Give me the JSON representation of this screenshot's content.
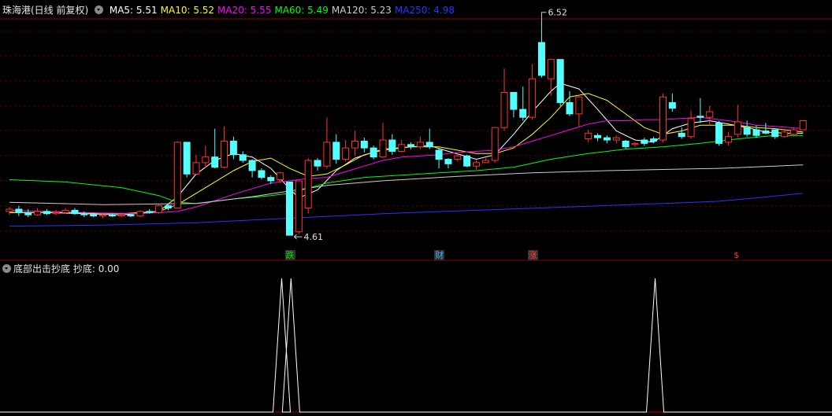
{
  "header": {
    "title": "珠海港(日线 前复权)",
    "ma_items": [
      {
        "label": "MA5: 5.51",
        "color": "#ffffff"
      },
      {
        "label": "MA10: 5.52",
        "color": "#ffff00"
      },
      {
        "label": "MA20: 5.55",
        "color": "#ff00ff"
      },
      {
        "label": "MA60: 5.49",
        "color": "#00ff00"
      },
      {
        "label": "MA120: 5.23",
        "color": "#cccccc"
      },
      {
        "label": "MA250: 4.98",
        "color": "#3030ff"
      }
    ]
  },
  "sub_header": {
    "title": "底部出击抄底",
    "value_label": "抄底: 0.00"
  },
  "markers": [
    {
      "text": "跌",
      "color": "#00e000",
      "bg": "#303030",
      "index": 30
    },
    {
      "text": "财",
      "color": "#4aa8ff",
      "bg": "#303030",
      "index": 46
    },
    {
      "text": "涨",
      "color": "#ff4040",
      "bg": "#303030",
      "index": 56
    },
    {
      "text": "$",
      "color": "#ff3030",
      "bg": "#000000",
      "index": 78
    }
  ],
  "chart_data": {
    "type": "candlestick",
    "price_range": [
      4.5,
      6.65
    ],
    "high_label": "6.52",
    "low_label": "4.61",
    "candles": [
      [
        4.82,
        4.84,
        4.86,
        4.79
      ],
      [
        4.84,
        4.81,
        4.87,
        4.78
      ],
      [
        4.81,
        4.79,
        4.84,
        4.77
      ],
      [
        4.79,
        4.82,
        4.85,
        4.78
      ],
      [
        4.82,
        4.8,
        4.84,
        4.79
      ],
      [
        4.8,
        4.81,
        4.83,
        4.79
      ],
      [
        4.81,
        4.83,
        4.85,
        4.8
      ],
      [
        4.83,
        4.8,
        4.85,
        4.79
      ],
      [
        4.8,
        4.79,
        4.82,
        4.77
      ],
      [
        4.79,
        4.78,
        4.81,
        4.77
      ],
      [
        4.78,
        4.79,
        4.8,
        4.76
      ],
      [
        4.79,
        4.78,
        4.8,
        4.77
      ],
      [
        4.78,
        4.79,
        4.81,
        4.77
      ],
      [
        4.79,
        4.78,
        4.8,
        4.77
      ],
      [
        4.78,
        4.82,
        4.83,
        4.77
      ],
      [
        4.82,
        4.81,
        4.84,
        4.8
      ],
      [
        4.81,
        4.87,
        4.88,
        4.8
      ],
      [
        4.87,
        4.85,
        4.89,
        4.83
      ],
      [
        4.85,
        5.43,
        5.44,
        4.85
      ],
      [
        5.43,
        5.15,
        5.43,
        5.12
      ],
      [
        5.15,
        5.25,
        5.32,
        5.14
      ],
      [
        5.25,
        5.3,
        5.4,
        5.2
      ],
      [
        5.3,
        5.21,
        5.55,
        5.2
      ],
      [
        5.21,
        5.44,
        5.57,
        5.2
      ],
      [
        5.44,
        5.32,
        5.48,
        5.28
      ],
      [
        5.32,
        5.27,
        5.35,
        5.25
      ],
      [
        5.27,
        5.18,
        5.28,
        5.12
      ],
      [
        5.18,
        5.12,
        5.2,
        5.1
      ],
      [
        5.12,
        5.09,
        5.14,
        5.06
      ],
      [
        5.1,
        5.16,
        5.17,
        5.07
      ],
      [
        5.08,
        4.61,
        5.08,
        4.61
      ],
      [
        4.64,
        5.09,
        5.09,
        4.62
      ],
      [
        4.85,
        5.27,
        5.29,
        4.8
      ],
      [
        5.27,
        5.22,
        5.29,
        5.18
      ],
      [
        5.22,
        5.43,
        5.65,
        5.2
      ],
      [
        5.43,
        5.28,
        5.5,
        5.24
      ],
      [
        5.28,
        5.38,
        5.45,
        5.26
      ],
      [
        5.38,
        5.44,
        5.53,
        5.31
      ],
      [
        5.44,
        5.38,
        5.47,
        5.34
      ],
      [
        5.38,
        5.3,
        5.4,
        5.28
      ],
      [
        5.3,
        5.45,
        5.6,
        5.29
      ],
      [
        5.45,
        5.35,
        5.5,
        5.32
      ],
      [
        5.35,
        5.41,
        5.45,
        5.34
      ],
      [
        5.41,
        5.39,
        5.43,
        5.37
      ],
      [
        5.39,
        5.43,
        5.48,
        5.37
      ],
      [
        5.43,
        5.39,
        5.55,
        5.37
      ],
      [
        5.36,
        5.28,
        5.38,
        5.2
      ],
      [
        5.28,
        5.24,
        5.29,
        5.2
      ],
      [
        5.28,
        5.31,
        5.33,
        5.26
      ],
      [
        5.31,
        5.22,
        5.32,
        5.21
      ],
      [
        5.22,
        5.25,
        5.27,
        5.19
      ],
      [
        5.25,
        5.27,
        5.29,
        5.25
      ],
      [
        5.27,
        5.56,
        5.56,
        5.25
      ],
      [
        5.56,
        5.87,
        6.08,
        5.53
      ],
      [
        5.87,
        5.72,
        5.85,
        5.65
      ],
      [
        5.72,
        5.65,
        5.92,
        5.62
      ],
      [
        5.65,
        5.99,
        6.12,
        5.63
      ],
      [
        6.31,
        6.02,
        6.52,
        6.0
      ],
      [
        5.99,
        6.16,
        6.13,
        5.84
      ],
      [
        6.16,
        5.78,
        6.1,
        5.75
      ],
      [
        5.78,
        5.68,
        5.88,
        5.66
      ],
      [
        5.68,
        5.83,
        5.85,
        5.57
      ],
      [
        5.46,
        5.51,
        5.54,
        5.43
      ],
      [
        5.49,
        5.47,
        5.51,
        5.44
      ],
      [
        5.47,
        5.45,
        5.49,
        5.42
      ],
      [
        5.45,
        5.47,
        5.49,
        5.42
      ],
      [
        5.44,
        5.39,
        5.45,
        5.37
      ],
      [
        5.41,
        5.42,
        5.43,
        5.39
      ],
      [
        5.45,
        5.42,
        5.47,
        5.4
      ],
      [
        5.46,
        5.44,
        5.48,
        5.42
      ],
      [
        5.45,
        5.83,
        5.86,
        5.43
      ],
      [
        5.78,
        5.73,
        5.86,
        5.7
      ],
      [
        5.51,
        5.48,
        5.56,
        5.46
      ],
      [
        5.48,
        5.64,
        5.71,
        5.46
      ],
      [
        5.66,
        5.65,
        5.82,
        5.6
      ],
      [
        5.65,
        5.7,
        5.75,
        5.58
      ],
      [
        5.6,
        5.42,
        5.62,
        5.4
      ],
      [
        5.43,
        5.48,
        5.52,
        5.4
      ],
      [
        5.5,
        5.61,
        5.76,
        5.47
      ],
      [
        5.56,
        5.5,
        5.62,
        5.48
      ],
      [
        5.54,
        5.49,
        5.58,
        5.47
      ],
      [
        5.53,
        5.51,
        5.6,
        5.5
      ],
      [
        5.54,
        5.48,
        5.51,
        5.46
      ],
      [
        5.48,
        5.52,
        5.55,
        5.47
      ],
      [
        5.5,
        5.54,
        5.56,
        5.48
      ],
      [
        5.54,
        5.62,
        5.62,
        5.54
      ]
    ],
    "ma_lines": [
      {
        "name": "MA5",
        "color": "#ffffff",
        "points": [
          [
            0,
            4.81
          ],
          [
            4,
            4.81
          ],
          [
            8,
            4.8
          ],
          [
            12,
            4.79
          ],
          [
            16,
            4.82
          ],
          [
            18,
            4.95
          ],
          [
            20,
            5.15
          ],
          [
            22,
            5.27
          ],
          [
            24,
            5.33
          ],
          [
            26,
            5.3
          ],
          [
            28,
            5.2
          ],
          [
            30,
            5.02
          ],
          [
            31,
            4.94
          ],
          [
            33,
            5.01
          ],
          [
            35,
            5.18
          ],
          [
            37,
            5.29
          ],
          [
            40,
            5.37
          ],
          [
            43,
            5.39
          ],
          [
            45,
            5.4
          ],
          [
            47,
            5.35
          ],
          [
            50,
            5.28
          ],
          [
            52,
            5.32
          ],
          [
            54,
            5.5
          ],
          [
            56,
            5.7
          ],
          [
            58,
            5.88
          ],
          [
            59,
            5.95
          ],
          [
            61,
            5.9
          ],
          [
            63,
            5.72
          ],
          [
            65,
            5.53
          ],
          [
            67,
            5.45
          ],
          [
            69,
            5.43
          ],
          [
            71,
            5.55
          ],
          [
            73,
            5.6
          ],
          [
            75,
            5.62
          ],
          [
            77,
            5.59
          ],
          [
            79,
            5.56
          ],
          [
            81,
            5.52
          ],
          [
            83,
            5.51
          ],
          [
            85,
            5.51
          ]
        ]
      },
      {
        "name": "MA10",
        "color": "#ffff00",
        "points": [
          [
            0,
            4.81
          ],
          [
            6,
            4.81
          ],
          [
            12,
            4.8
          ],
          [
            16,
            4.82
          ],
          [
            18,
            4.88
          ],
          [
            20,
            4.98
          ],
          [
            22,
            5.08
          ],
          [
            24,
            5.18
          ],
          [
            26,
            5.26
          ],
          [
            28,
            5.29
          ],
          [
            30,
            5.2
          ],
          [
            32,
            5.13
          ],
          [
            34,
            5.15
          ],
          [
            36,
            5.23
          ],
          [
            38,
            5.32
          ],
          [
            40,
            5.36
          ],
          [
            43,
            5.39
          ],
          [
            46,
            5.39
          ],
          [
            48,
            5.36
          ],
          [
            50,
            5.33
          ],
          [
            52,
            5.33
          ],
          [
            54,
            5.38
          ],
          [
            56,
            5.5
          ],
          [
            58,
            5.65
          ],
          [
            60,
            5.83
          ],
          [
            62,
            5.86
          ],
          [
            64,
            5.8
          ],
          [
            66,
            5.68
          ],
          [
            68,
            5.56
          ],
          [
            70,
            5.5
          ],
          [
            72,
            5.53
          ],
          [
            74,
            5.58
          ],
          [
            76,
            5.58
          ],
          [
            78,
            5.58
          ],
          [
            80,
            5.56
          ],
          [
            82,
            5.55
          ],
          [
            85,
            5.52
          ]
        ]
      },
      {
        "name": "MA20",
        "color": "#ff00ff",
        "points": [
          [
            0,
            4.83
          ],
          [
            8,
            4.81
          ],
          [
            14,
            4.8
          ],
          [
            18,
            4.82
          ],
          [
            20,
            4.86
          ],
          [
            24,
            4.97
          ],
          [
            28,
            5.07
          ],
          [
            30,
            5.09
          ],
          [
            32,
            5.11
          ],
          [
            34,
            5.12
          ],
          [
            36,
            5.17
          ],
          [
            38,
            5.22
          ],
          [
            40,
            5.27
          ],
          [
            42,
            5.3
          ],
          [
            44,
            5.31
          ],
          [
            46,
            5.32
          ],
          [
            48,
            5.34
          ],
          [
            50,
            5.35
          ],
          [
            52,
            5.36
          ],
          [
            54,
            5.39
          ],
          [
            56,
            5.44
          ],
          [
            58,
            5.49
          ],
          [
            60,
            5.54
          ],
          [
            62,
            5.59
          ],
          [
            64,
            5.62
          ],
          [
            66,
            5.62
          ],
          [
            68,
            5.63
          ],
          [
            70,
            5.63
          ],
          [
            72,
            5.64
          ],
          [
            74,
            5.65
          ],
          [
            76,
            5.63
          ],
          [
            78,
            5.61
          ],
          [
            80,
            5.58
          ],
          [
            82,
            5.57
          ],
          [
            85,
            5.55
          ]
        ]
      },
      {
        "name": "MA60",
        "color": "#00ff00",
        "points": [
          [
            0,
            5.1
          ],
          [
            6,
            5.08
          ],
          [
            12,
            5.03
          ],
          [
            16,
            4.96
          ],
          [
            18,
            4.9
          ],
          [
            20,
            4.89
          ],
          [
            24,
            4.93
          ],
          [
            28,
            4.96
          ],
          [
            30,
            4.98
          ],
          [
            34,
            5.07
          ],
          [
            38,
            5.12
          ],
          [
            42,
            5.14
          ],
          [
            46,
            5.16
          ],
          [
            50,
            5.18
          ],
          [
            54,
            5.21
          ],
          [
            58,
            5.28
          ],
          [
            62,
            5.33
          ],
          [
            66,
            5.37
          ],
          [
            70,
            5.39
          ],
          [
            74,
            5.42
          ],
          [
            78,
            5.46
          ],
          [
            82,
            5.49
          ],
          [
            85,
            5.49
          ]
        ]
      },
      {
        "name": "MA120",
        "color": "#cccccc",
        "points": [
          [
            0,
            4.9
          ],
          [
            10,
            4.88
          ],
          [
            20,
            4.89
          ],
          [
            26,
            4.95
          ],
          [
            30,
            5.0
          ],
          [
            34,
            5.05
          ],
          [
            40,
            5.09
          ],
          [
            48,
            5.13
          ],
          [
            56,
            5.16
          ],
          [
            64,
            5.18
          ],
          [
            70,
            5.19
          ],
          [
            76,
            5.2
          ],
          [
            82,
            5.22
          ],
          [
            85,
            5.23
          ]
        ]
      },
      {
        "name": "MA250",
        "color": "#3030ff",
        "points": [
          [
            0,
            4.69
          ],
          [
            10,
            4.7
          ],
          [
            20,
            4.72
          ],
          [
            30,
            4.76
          ],
          [
            40,
            4.8
          ],
          [
            50,
            4.83
          ],
          [
            60,
            4.86
          ],
          [
            70,
            4.89
          ],
          [
            76,
            4.91
          ],
          [
            80,
            4.94
          ],
          [
            85,
            4.98
          ]
        ]
      }
    ],
    "indicator": {
      "name": "抄底",
      "value": "0.00",
      "values_by_index": {
        "30": 1,
        "31": 1,
        "70": 1
      }
    }
  }
}
